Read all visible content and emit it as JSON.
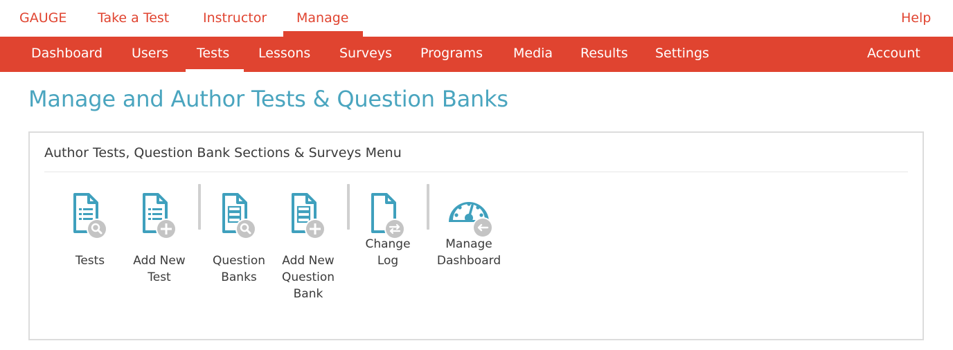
{
  "topnav": {
    "brand": "GAUGE",
    "take_test": "Take a Test",
    "instructor": "Instructor",
    "manage": "Manage",
    "help": "Help"
  },
  "subnav": {
    "dashboard": "Dashboard",
    "users": "Users",
    "tests": "Tests",
    "lessons": "Lessons",
    "surveys": "Surveys",
    "programs": "Programs",
    "media": "Media",
    "results": "Results",
    "settings": "Settings",
    "account": "Account"
  },
  "page": {
    "title": "Manage and Author Tests & Question Banks"
  },
  "panel": {
    "title": "Author Tests, Question Bank Sections & Surveys Menu",
    "tiles": [
      {
        "line1": "Tests",
        "line2": "",
        "line3": ""
      },
      {
        "line1": "Add New",
        "line2": "Test",
        "line3": ""
      },
      {
        "line1": "Question",
        "line2": "Banks",
        "line3": ""
      },
      {
        "line1": "Add New",
        "line2": "Question",
        "line3": "Bank"
      },
      {
        "line1": "Change",
        "line2": "Log",
        "line3": ""
      },
      {
        "line1": "Manage",
        "line2": "Dashboard",
        "line3": ""
      }
    ]
  },
  "colors": {
    "brand_red": "#e04430",
    "title_blue": "#4aa5bf",
    "icon_blue": "#3fa0bd",
    "badge_gray": "#c4c4c4"
  }
}
